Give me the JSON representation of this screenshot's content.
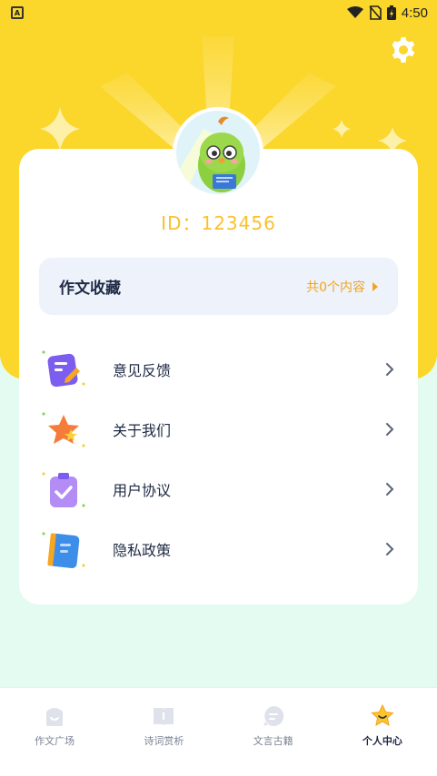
{
  "status_bar": {
    "time": "4:50"
  },
  "profile": {
    "id_text": "ID：123456"
  },
  "favorites": {
    "title": "作文收藏",
    "count_text": "共0个内容"
  },
  "menu": [
    {
      "label": "意见反馈",
      "icon": "feedback-icon"
    },
    {
      "label": "关于我们",
      "icon": "star-icon"
    },
    {
      "label": "用户协议",
      "icon": "clipboard-check-icon"
    },
    {
      "label": "隐私政策",
      "icon": "notebook-icon"
    }
  ],
  "bottom_nav": [
    {
      "label": "作文广场",
      "icon": "essay-square-icon",
      "active": false
    },
    {
      "label": "诗词赏析",
      "icon": "book-icon",
      "active": false
    },
    {
      "label": "文言古籍",
      "icon": "chat-bubble-icon",
      "active": false
    },
    {
      "label": "个人中心",
      "icon": "profile-star-icon",
      "active": true
    }
  ],
  "colors": {
    "header_yellow": "#fbd62b",
    "accent_orange": "#f2a41c",
    "id_yellow": "#fbc02d",
    "page_mint": "#e4fbf1"
  }
}
